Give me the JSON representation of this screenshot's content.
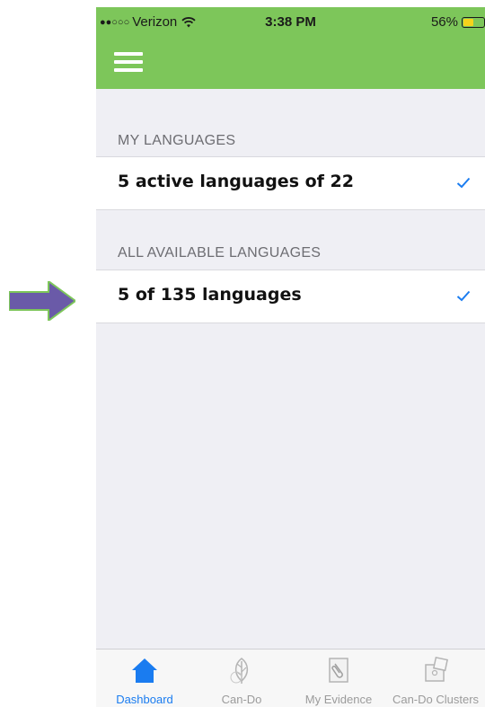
{
  "status_bar": {
    "signal": "●●○○○",
    "carrier": "Verizon",
    "time": "3:38 PM",
    "battery_percent": "56%",
    "battery_level": 0.56
  },
  "nav_bar": {
    "menu_icon": "hamburger-menu-icon",
    "background": "#7dc65a"
  },
  "sections": {
    "my_languages": {
      "header": "MY LANGUAGES",
      "row_label": "5 active languages of 22"
    },
    "all_languages": {
      "header": "ALL AVAILABLE LANGUAGES",
      "row_label": "5 of 135 languages"
    }
  },
  "tab_bar": {
    "tabs": [
      {
        "label": "Dashboard",
        "icon": "house-icon",
        "active": true
      },
      {
        "label": "Can-Do",
        "icon": "leaf-icon",
        "active": false
      },
      {
        "label": "My Evidence",
        "icon": "paperclip-document-icon",
        "active": false
      },
      {
        "label": "Can-Do Clusters",
        "icon": "puzzle-icon",
        "active": false
      }
    ]
  },
  "colors": {
    "accent": "#1a7cf0",
    "brand_green": "#7dc65a",
    "annotation_arrow": "#6a5aa8"
  }
}
